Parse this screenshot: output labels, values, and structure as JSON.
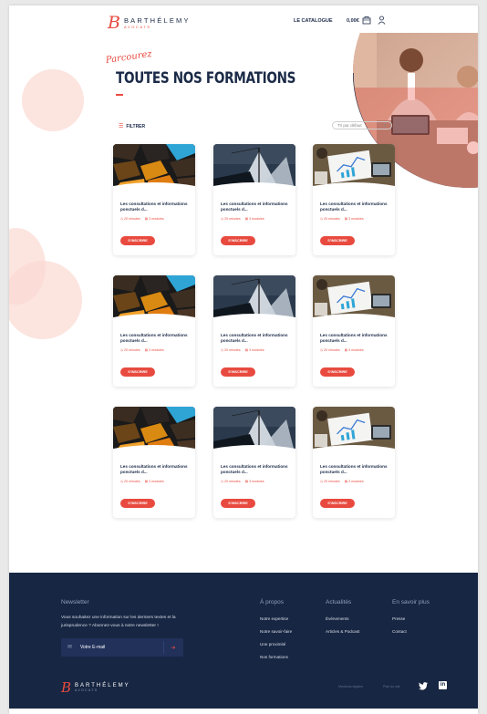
{
  "header": {
    "logo_name": "BARTHÉLEMY",
    "logo_sub": "AVOCATS",
    "nav_catalogue": "LE CATALOGUE",
    "cart_amount": "0,00€"
  },
  "hero": {
    "kicker": "Parcourez",
    "title": "TOUTES NOS FORMATIONS"
  },
  "toolbar": {
    "filter_label": "FILTRER",
    "sort_selected": "Tri par défaut"
  },
  "cards": [
    {
      "title": "Les consultations et informations ponctuels d...",
      "duration": "20 minutes",
      "modules": "3 modules",
      "cta": "S'INSCRIRE",
      "thumb": "gold-orange-shapes"
    },
    {
      "title": "Les consultations et informations ponctuels d...",
      "duration": "20 minutes",
      "modules": "3 modules",
      "cta": "S'INSCRIRE",
      "thumb": "sailboat"
    },
    {
      "title": "Les consultations et informations ponctuels d...",
      "duration": "20 minutes",
      "modules": "3 modules",
      "cta": "S'INSCRIRE",
      "thumb": "desk-charts"
    },
    {
      "title": "Les consultations et informations ponctuels d...",
      "duration": "20 minutes",
      "modules": "3 modules",
      "cta": "S'INSCRIRE",
      "thumb": "gold-orange-shapes"
    },
    {
      "title": "Les consultations et informations ponctuels d...",
      "duration": "20 minutes",
      "modules": "3 modules",
      "cta": "S'INSCRIRE",
      "thumb": "sailboat"
    },
    {
      "title": "Les consultations et informations ponctuels d...",
      "duration": "20 minutes",
      "modules": "3 modules",
      "cta": "S'INSCRIRE",
      "thumb": "desk-charts"
    },
    {
      "title": "Les consultations et informations ponctuels d...",
      "duration": "20 minutes",
      "modules": "3 modules",
      "cta": "S'INSCRIRE",
      "thumb": "gold-orange-shapes"
    },
    {
      "title": "Les consultations et informations ponctuels d...",
      "duration": "20 minutes",
      "modules": "3 modules",
      "cta": "S'INSCRIRE",
      "thumb": "sailboat"
    },
    {
      "title": "Les consultations et informations ponctuels d...",
      "duration": "20 minutes",
      "modules": "3 modules",
      "cta": "S'INSCRIRE",
      "thumb": "desk-charts"
    }
  ],
  "footer": {
    "newsletter": {
      "heading": "Newsletter",
      "text": "Vous souhaitez une information sur les derniers textes et la jurisprudence ? Abonnez-vous à notre newsletter !",
      "placeholder": "Votre E-mail"
    },
    "columns": [
      {
        "heading": "À propos",
        "links": [
          "Notre expertise",
          "Notre savoir-faire",
          "Une proximité",
          "Nos formations"
        ]
      },
      {
        "heading": "Actualités",
        "links": [
          "Événements",
          "Articles & Podcast"
        ]
      },
      {
        "heading": "En savoir plus",
        "links": [
          "Presse",
          "Contact"
        ]
      }
    ],
    "logo_name": "BARTHÉLEMY",
    "logo_sub": "AVOCATS",
    "legal": [
      "Mentions légales",
      "Plan du site"
    ]
  },
  "colors": {
    "accent": "#e84a3f",
    "navy": "#172642",
    "peach": "#fbd9d2"
  },
  "icons": [
    "cart-icon",
    "user-icon",
    "filter-icon",
    "clock-icon",
    "modules-icon",
    "mail-icon",
    "arrow-right-icon",
    "twitter-icon",
    "linkedin-icon"
  ]
}
